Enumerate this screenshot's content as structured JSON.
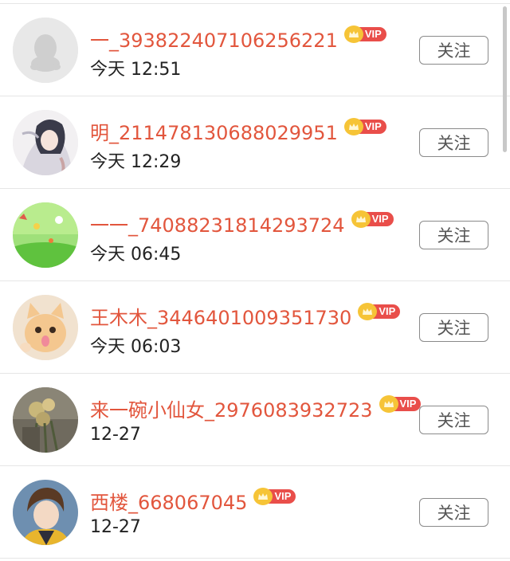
{
  "users": [
    {
      "name": "一_393822407106256221",
      "time": "今天 12:51",
      "vip_label": "VIP",
      "button_label": "关注",
      "avatar": "default-penguin-avatar"
    },
    {
      "name": "明_211478130688029951",
      "time": "今天 12:29",
      "vip_label": "VIP",
      "button_label": "关注",
      "avatar": "anime-character-avatar"
    },
    {
      "name": "一一_74088231814293724",
      "time": "今天 06:45",
      "vip_label": "VIP",
      "button_label": "关注",
      "avatar": "green-landscape-avatar"
    },
    {
      "name": "王木木_3446401009351730",
      "time": "今天 06:03",
      "vip_label": "VIP",
      "button_label": "关注",
      "avatar": "cat-avatar"
    },
    {
      "name": "来一碗小仙女_2976083932723",
      "time": "12-27",
      "vip_label": "VIP",
      "button_label": "关注",
      "avatar": "flowers-avatar"
    },
    {
      "name": "西楼_668067045",
      "time": "12-27",
      "vip_label": "VIP",
      "button_label": "关注",
      "avatar": "anime-boy-avatar"
    }
  ],
  "colors": {
    "name": "#e2563d",
    "vip_tag": "#e94e4a",
    "crown": "#f6c437",
    "button_border": "#8a8a8a"
  }
}
